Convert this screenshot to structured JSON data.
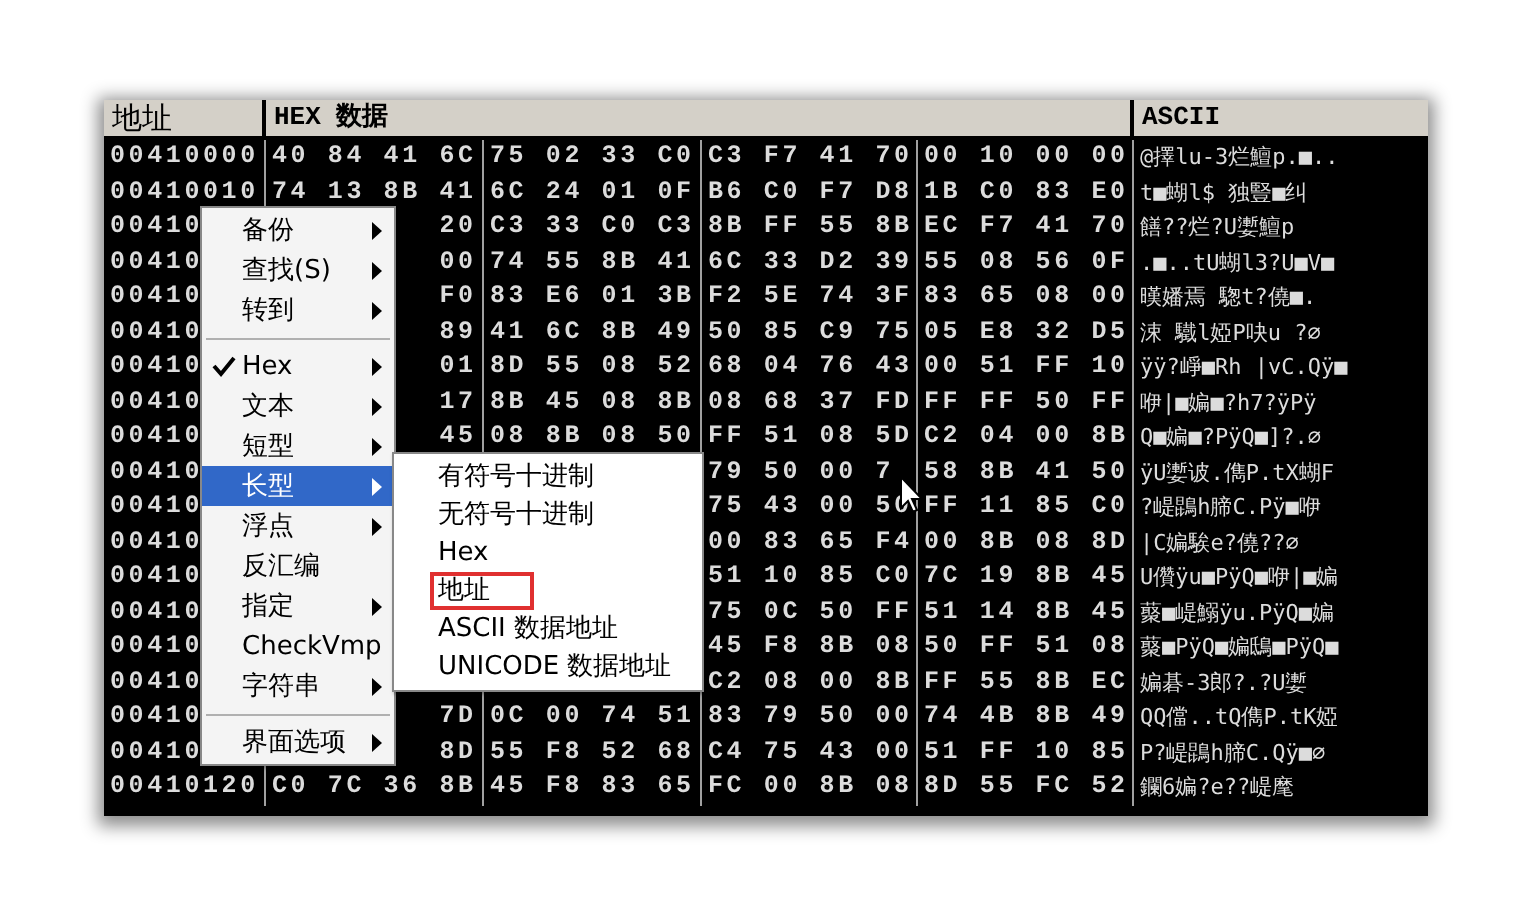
{
  "columns": {
    "address": "地址",
    "hex": "HEX 数据",
    "ascii": "ASCII"
  },
  "rows": [
    {
      "address": "00410000",
      "hex": {
        "group_1": "40 84 41 6C",
        "group_2": "75 02 33 C0",
        "group_3": "C3 F7 41 70",
        "group_4": "00 10 00 00"
      },
      "ascii": "@擇lu-3烂鱣p.■.."
    },
    {
      "address": "00410010",
      "hex": {
        "group_1": "74 13 8B 41",
        "group_2": "6C 24 01 0F",
        "group_3": "B6 C0 F7 D8",
        "group_4": "1B C0 83 E0"
      },
      "ascii": "t■蝴l$ 独豎■纠"
    },
    {
      "address": "00410",
      "hex": {
        "group_1": "20",
        "group_2": "C3 33 C0 C3",
        "group_3": "8B FF 55 8B",
        "group_4": "EC F7 41 70"
      },
      "ascii": "饍??烂?U嬱鱣p"
    },
    {
      "address": "00410",
      "hex": {
        "group_1": "00",
        "group_2": "74 55 8B 41",
        "group_3": "6C 33 D2 39",
        "group_4": "55 08 56 0F"
      },
      "ascii": ".■..tU蝴l3?U■V■"
    },
    {
      "address": "00410",
      "hex": {
        "group_1": "F0",
        "group_2": "83 E6 01 3B",
        "group_3": "F2 5E 74 3F",
        "group_4": "83 65 08 00"
      },
      "ascii": "暵嬏焉 騘t?僥■."
    },
    {
      "address": "00410",
      "hex": {
        "group_1": "89",
        "group_2": "41 6C 8B 49",
        "group_3": "50 85 C9 75",
        "group_4": "05 E8 32 D5"
      },
      "ascii": "涑 驖l婭P吷u ?∅"
    },
    {
      "address": "00410",
      "hex": {
        "group_1": "01",
        "group_2": "8D 55 08 52",
        "group_3": "68 04 76 43",
        "group_4": "00 51 FF 10"
      },
      "ascii": "ÿÿ?崢■Rh |vC.Qÿ■"
    },
    {
      "address": "00410",
      "hex": {
        "group_1": "17",
        "group_2": "8B 45 08 8B",
        "group_3": "08 68 37 FD",
        "group_4": "FF FF 50 FF"
      },
      "ascii": "咿|■媥■?h7?ÿPÿ"
    },
    {
      "address": "00410",
      "hex": {
        "group_1": "45",
        "group_2": "08 8B 08 50",
        "group_3": "FF 51 08 5D",
        "group_4": "C2 04 00 8B"
      },
      "ascii": "Q■媥■?PÿQ■]?.∅"
    },
    {
      "address": "00410",
      "hex": {
        "group_3": "79 50 00 7",
        "group_4": "58 8B 41 50"
      },
      "ascii": "ÿU嬱诐.儁P.tX蝴F"
    },
    {
      "address": "00410",
      "hex": {
        "group_3": "75 43 00 50",
        "group_4": "FF 11 85 C0"
      },
      "ascii": "?崼鵾h腣C.Pÿ■咿"
    },
    {
      "address": "00410",
      "hex": {
        "group_3": "00 83 65 F4",
        "group_4": "00 8B 08 8D"
      },
      "ascii": "|C媥騃e?僥??∅"
    },
    {
      "address": "00410",
      "hex": {
        "group_3": "51 10 85 C0",
        "group_4": "7C 19 8B 45"
      },
      "ascii": "U儹ÿu■PÿQ■咿|■媥"
    },
    {
      "address": "00410",
      "hex": {
        "group_3": "75 0C 50 FF",
        "group_4": "51 14 8B 45"
      },
      "ascii": "藂■崼鰯ÿu.PÿQ■媥"
    },
    {
      "address": "00410",
      "hex": {
        "group_3": "45 F8 8B 08",
        "group_4": "50 FF 51 08"
      },
      "ascii": "藂■PÿQ■媥鴟■PÿQ■"
    },
    {
      "address": "00410",
      "hex": {
        "group_3": "C2 08 00 8B",
        "group_4": "FF 55 8B EC"
      },
      "ascii": "媥碁-3郎?.?U嬱"
    },
    {
      "address": "00410",
      "hex": {
        "group_1": "7D",
        "group_2": "0C 00 74 51",
        "group_3": "83 79 50 00",
        "group_4": "74 4B 8B 49"
      },
      "ascii": "QQ儅..tQ儁P.tK婭"
    },
    {
      "address": "00410",
      "hex": {
        "group_1": "8D",
        "group_2": "55 F8 52 68",
        "group_3": "C4 75 43 00",
        "group_4": "51 FF 10 85"
      },
      "ascii": "P?崼鵾h腣C.Qÿ■∅"
    },
    {
      "address": "00410120",
      "hex": {
        "group_1": "C0 7C 36 8B",
        "group_2": "45 F8 83 65",
        "group_3": "FC 00 8B 08",
        "group_4": "8D 55 FC 52"
      },
      "ascii": "鑭6媥?e??崼麾"
    }
  ],
  "context_menu": {
    "items": [
      {
        "kind": "item",
        "label": "备份",
        "submenu": true,
        "checked": false,
        "selected": false
      },
      {
        "kind": "item",
        "label": "查找(S)",
        "submenu": true,
        "checked": false,
        "selected": false
      },
      {
        "kind": "item",
        "label": "转到",
        "submenu": true,
        "checked": false,
        "selected": false
      },
      {
        "kind": "separator"
      },
      {
        "kind": "item",
        "label": "Hex",
        "submenu": true,
        "checked": true,
        "selected": false
      },
      {
        "kind": "item",
        "label": "文本",
        "submenu": true,
        "checked": false,
        "selected": false
      },
      {
        "kind": "item",
        "label": "短型",
        "submenu": true,
        "checked": false,
        "selected": false
      },
      {
        "kind": "item",
        "label": "长型",
        "submenu": true,
        "checked": false,
        "selected": true
      },
      {
        "kind": "item",
        "label": "浮点",
        "submenu": true,
        "checked": false,
        "selected": false
      },
      {
        "kind": "item",
        "label": "反汇编",
        "submenu": false,
        "checked": false,
        "selected": false
      },
      {
        "kind": "item",
        "label": "指定",
        "submenu": true,
        "checked": false,
        "selected": false
      },
      {
        "kind": "item",
        "label": "CheckVmp",
        "submenu": false,
        "checked": false,
        "selected": false
      },
      {
        "kind": "item",
        "label": "字符串",
        "submenu": true,
        "checked": false,
        "selected": false
      },
      {
        "kind": "separator"
      },
      {
        "kind": "item",
        "label": "界面选项",
        "submenu": true,
        "checked": false,
        "selected": false
      }
    ]
  },
  "submenu": {
    "items": [
      {
        "label": "有符号十进制",
        "marked": false
      },
      {
        "label": "无符号十进制",
        "marked": false
      },
      {
        "label": "Hex",
        "marked": false
      },
      {
        "label": "地址",
        "marked": true
      },
      {
        "label": "ASCII 数据地址",
        "marked": false
      },
      {
        "label": "UNICODE 数据地址",
        "marked": false
      }
    ]
  }
}
